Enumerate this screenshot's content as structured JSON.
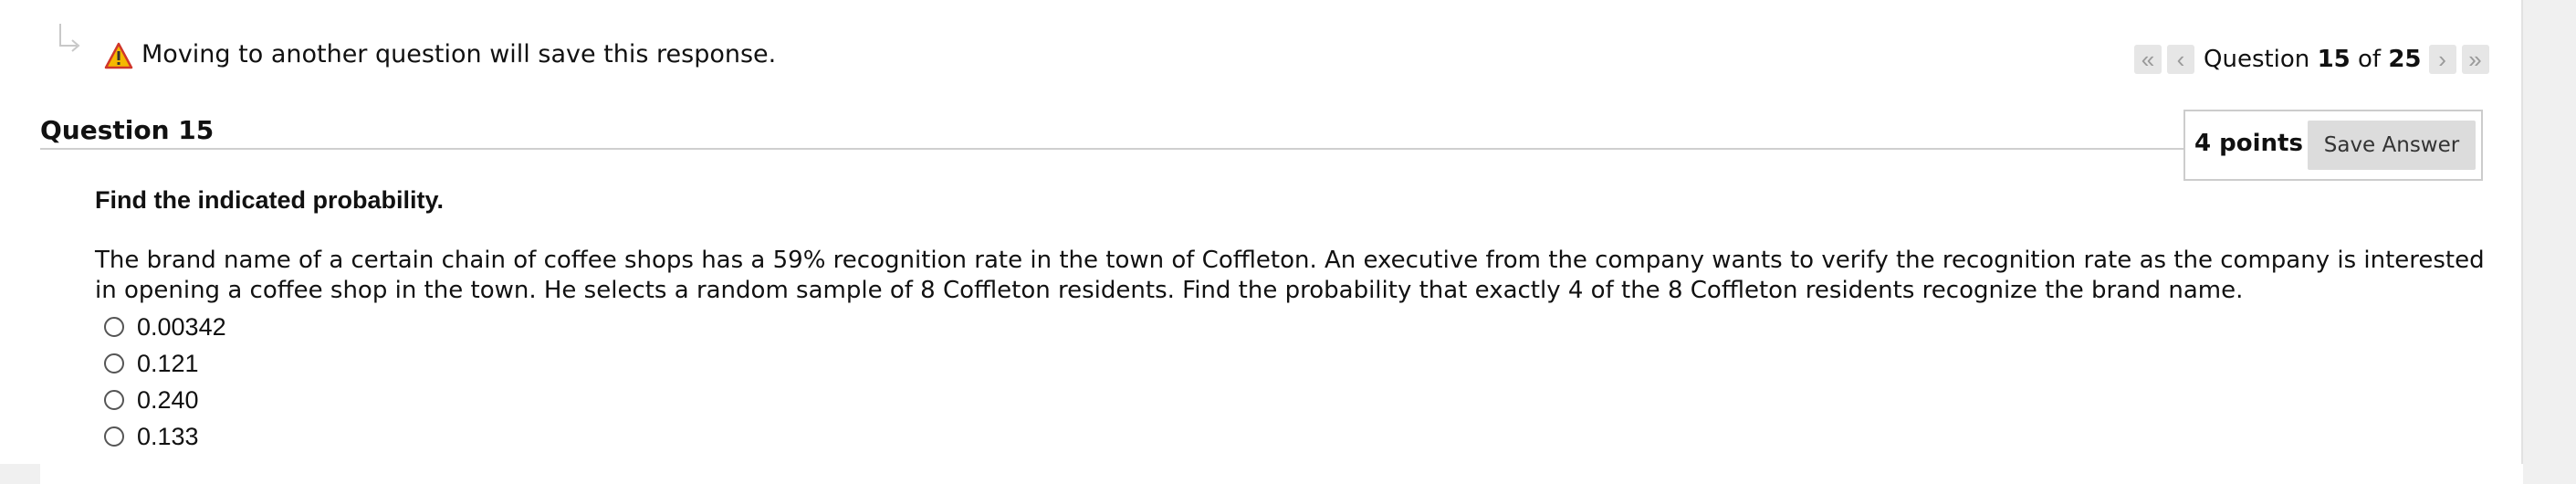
{
  "warning": {
    "icon": "warning-triangle-icon",
    "text": "Moving to another question will save this response."
  },
  "pager": {
    "prefix": "Question",
    "current": "15",
    "of": "of",
    "total": "25",
    "first_icon": "double-chevron-left-icon",
    "prev_icon": "chevron-left-icon",
    "next_icon": "chevron-right-icon",
    "last_icon": "double-chevron-right-icon"
  },
  "question": {
    "title": "Question 15",
    "points": "4 points",
    "save_label": "Save Answer",
    "instruction": "Find the indicated probability.",
    "text": "The brand name of a certain chain of coffee shops has a 59% recognition rate in the town of Coffleton. An executive from the company wants to verify the recognition rate as the company is interested in opening a coffee shop in the town. He selects a random sample of 8 Coffleton residents. Find the probability that exactly 4 of the 8 Coffleton residents recognize the brand name.",
    "options": [
      "0.00342",
      "0.121",
      "0.240",
      "0.133"
    ]
  },
  "colors": {
    "warning_yellow": "#f5b800",
    "warning_red": "#d0362a",
    "button_gray": "#dcdcdc"
  }
}
